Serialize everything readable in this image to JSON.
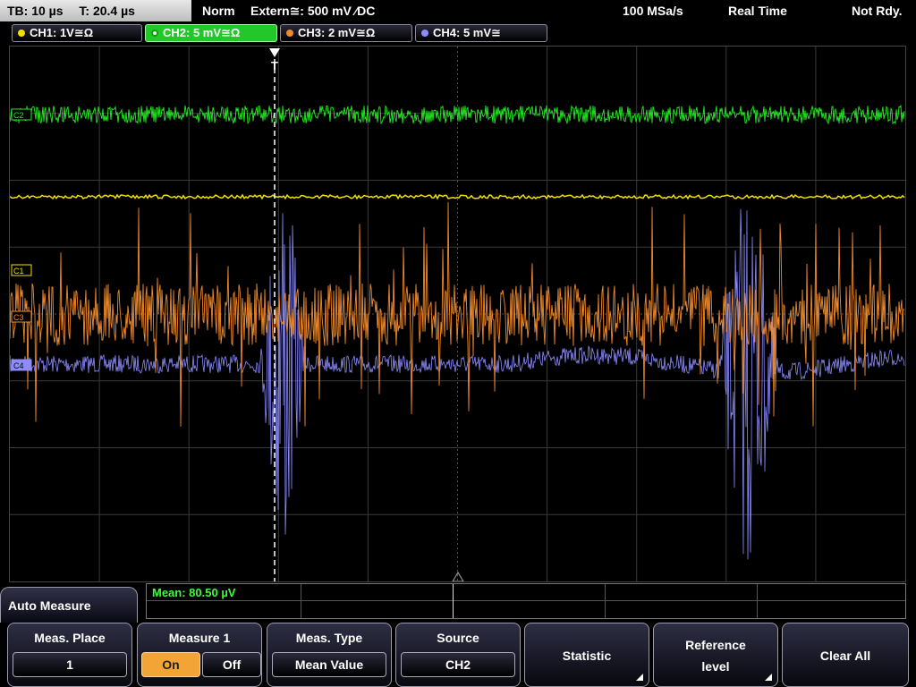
{
  "topbar": {
    "timebase": "TB: 10 µs",
    "trigger_time": "T: 20.4 µs",
    "mode": "Norm",
    "trigger": "Extern≅: 500 mV ⁄DC",
    "sample_rate": "100 MSa/s",
    "acq_mode": "Real Time",
    "status": "Not Rdy."
  },
  "channels": [
    {
      "label": "CH1: 1V≅Ω",
      "color": "#f0e000",
      "active": false
    },
    {
      "label": "CH2: 5 mV≅Ω",
      "color": "#22ee22",
      "active": true
    },
    {
      "label": "CH3: 2 mV≅Ω",
      "color": "#f08a2a",
      "active": false
    },
    {
      "label": "CH4: 5 mV≅",
      "color": "#8c8cff",
      "active": false
    }
  ],
  "markers": {
    "c2": "C2",
    "c1": "C1",
    "c3": "C3",
    "c4": "C4",
    "trigger": "T"
  },
  "measurement": {
    "label": "Mean: 80.50 µV"
  },
  "auto_measure": "Auto Measure",
  "softkeys": {
    "meas_place": {
      "title": "Meas. Place",
      "value": "1"
    },
    "measure1": {
      "title": "Measure 1",
      "on": "On",
      "off": "Off"
    },
    "meas_type": {
      "title": "Meas. Type",
      "value": "Mean Value"
    },
    "source": {
      "title": "Source",
      "value": "CH2"
    },
    "statistic": "Statistic",
    "reference_level_1": "Reference",
    "reference_level_2": "level",
    "clear_all": "Clear All"
  },
  "colors": {
    "ch1": "#f0e000",
    "ch2": "#22ee22",
    "ch3": "#f08a2a",
    "ch4": "#8c8cff"
  }
}
